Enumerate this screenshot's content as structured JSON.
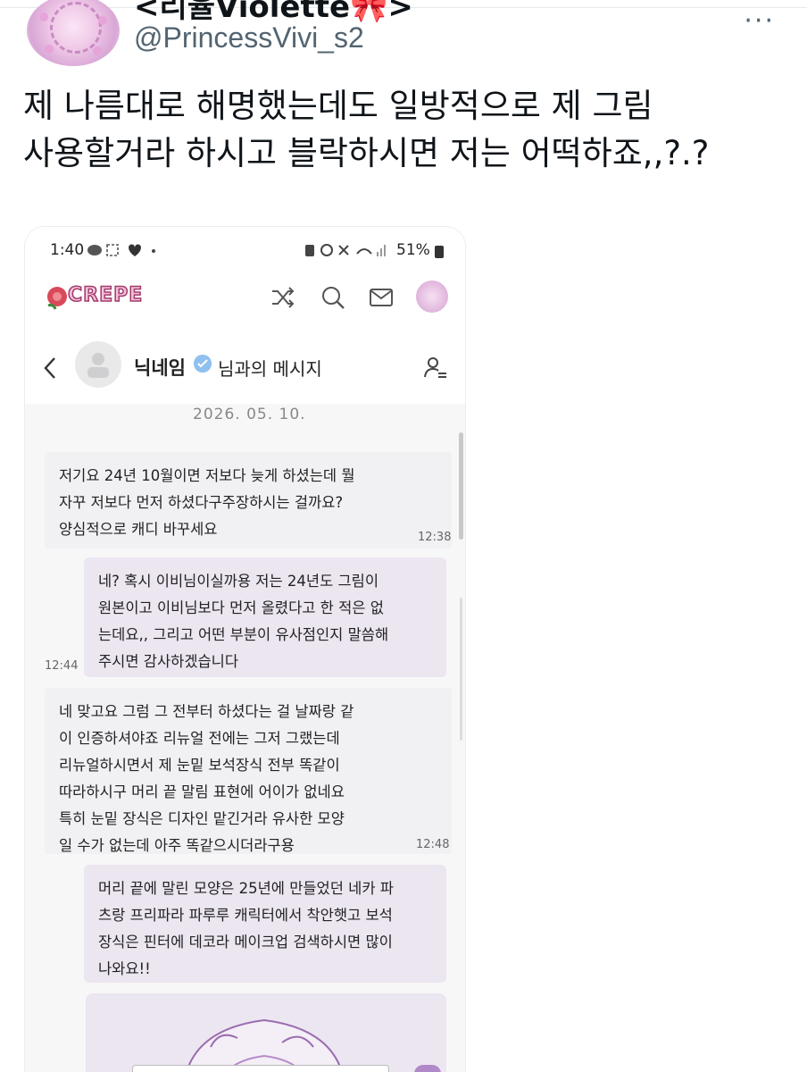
{
  "tweet": {
    "display_name": "<리율Violette🎀>",
    "handle": "@PrincessVivi_s2",
    "more_label": "···",
    "text": "제 나름대로 해명했는데도 일방적으로 제 그림\n사용할거라 하시고 블락하시면 저는 어떡하죠,,?.?"
  },
  "phone": {
    "status": {
      "time": "1:40",
      "battery": "51%"
    },
    "app": {
      "logo": "CREPE"
    },
    "chat_header": {
      "peer_name": "닉네임",
      "suffix": "님과의 메시지"
    },
    "date": "2026. 05. 10.",
    "messages": [
      {
        "side": "in",
        "text": "저기요 24년 10월이면 저보다 늦게 하셨는데 뭘\n자꾸 저보다 먼저 하셨다구주장하시는 걸까요?\n양심적으로 캐디 바꾸세요",
        "time": "12:38"
      },
      {
        "side": "out",
        "text": "네? 혹시 이비님이실까용 저는 24년도 그림이\n원본이고 이비님보다 먼저 올렸다고 한 적은 없\n는데요,, 그리고 어떤 부분이 유사점인지 말씀해\n주시면 감사하겠습니다",
        "time": "12:44"
      },
      {
        "side": "in",
        "text": "네 맞고요 그럼 그 전부터 하셨다는 걸 날짜랑 같\n이 인증하셔야죠 리뉴얼 전에는 그저 그랬는데\n리뉴얼하시면서 제 눈밑 보석장식 전부 똑같이\n따라하시구 머리 끝 말림 표현에 어이가 없네요\n특히 눈밑 장식은 디자인 맡긴거라 유사한 모양\n일 수가 없는데 아주 똑같으시더라구용",
        "time": "12:48"
      },
      {
        "side": "out",
        "text": "머리 끝에 말린 모양은 25년에 만들었던 네카 파\n츠랑 프리파라 파루루 캐릭터에서 착안햇고 보석\n장식은 핀터에 데코라 메이크업 검색하시면 많이\n나와요!!",
        "time": ""
      }
    ]
  }
}
